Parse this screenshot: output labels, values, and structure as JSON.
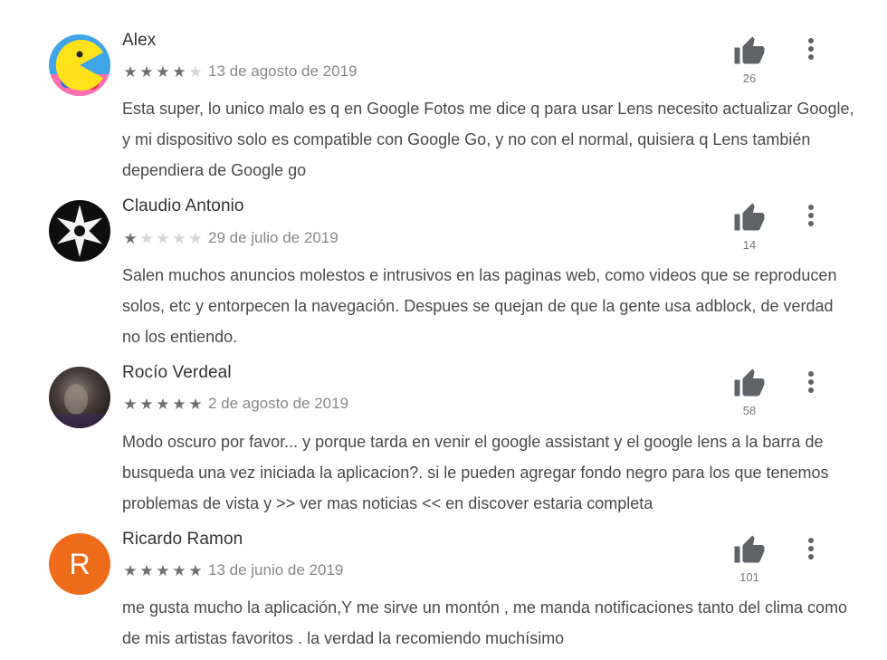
{
  "colors": {
    "star_on": "#6f6f6f",
    "star_off": "#d6d6d6",
    "thumb_icon": "#5f6368",
    "avatar_r_bg": "#ef6c1a"
  },
  "reviews": [
    {
      "author": "Alex",
      "rating": 4,
      "date": "13 de agosto de 2019",
      "text": "Esta super, lo unico malo es q en Google Fotos me dice q para usar Lens necesito actualizar Google, y mi dispositivo solo es compatible con Google Go, y no con el normal, quisiera q Lens también dependiera de Google go",
      "likes": "26",
      "avatar_icon": "pacman-avatar-icon"
    },
    {
      "author": "Claudio Antonio",
      "rating": 1,
      "date": "29 de julio de 2019",
      "text": "Salen muchos anuncios molestos e intrusivos en las paginas web, como videos que se reproducen solos, etc y entorpecen la navegación. Despues se quejan de que la gente usa adblock, de verdad no los entiendo.",
      "likes": "14",
      "avatar_icon": "shuriken-avatar-icon"
    },
    {
      "author": "Rocío Verdeal",
      "rating": 5,
      "date": "2 de agosto de 2019",
      "text": "Modo oscuro por favor... y porque tarda en venir el google assistant y el google lens a la barra de busqueda una vez iniciada la aplicacion?. si le pueden agregar fondo negro para los que tenemos problemas de vista y >> ver mas noticias << en discover estaria completa",
      "likes": "58",
      "avatar_icon": "photo-avatar-icon"
    },
    {
      "author": "Ricardo Ramon",
      "rating": 5,
      "date": "13 de junio de 2019",
      "text": "me gusta mucho la aplicación,Y me sirve un montón , me manda notificaciones tanto del clima como de mis artistas favoritos . la verdad la recomiendo muchísimo",
      "likes": "101",
      "avatar_letter": "R",
      "avatar_icon": "letter-avatar-icon"
    }
  ]
}
